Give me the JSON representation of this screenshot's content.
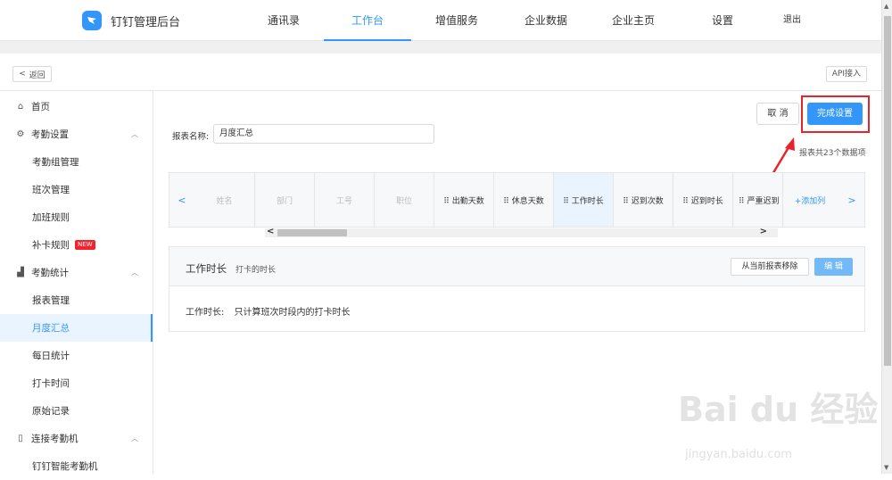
{
  "app": {
    "title": "钉钉管理后台"
  },
  "nav": [
    {
      "label": "通讯录",
      "active": false
    },
    {
      "label": "工作台",
      "active": true
    },
    {
      "label": "增值服务",
      "active": false
    },
    {
      "label": "企业数据",
      "active": false
    },
    {
      "label": "企业主页",
      "active": false
    },
    {
      "label": "设置",
      "active": false
    },
    {
      "label": "退出",
      "active": false
    }
  ],
  "subbar": {
    "back_label": "返回",
    "api_label": "API接入"
  },
  "sidebar": {
    "items": [
      {
        "label": "首页",
        "type": "group",
        "icon": "home-icon",
        "caret": false
      },
      {
        "label": "考勤设置",
        "type": "group",
        "icon": "settings-icon",
        "caret": true
      },
      {
        "label": "考勤组管理",
        "type": "sub"
      },
      {
        "label": "班次管理",
        "type": "sub"
      },
      {
        "label": "加班规则",
        "type": "sub"
      },
      {
        "label": "补卡规则",
        "type": "sub",
        "badge": "NEW"
      },
      {
        "label": "考勤统计",
        "type": "group",
        "icon": "chart-icon",
        "caret": true
      },
      {
        "label": "报表管理",
        "type": "sub"
      },
      {
        "label": "月度汇总",
        "type": "sub",
        "active": true
      },
      {
        "label": "每日统计",
        "type": "sub"
      },
      {
        "label": "打卡时间",
        "type": "sub"
      },
      {
        "label": "原始记录",
        "type": "sub"
      },
      {
        "label": "连接考勤机",
        "type": "group",
        "icon": "device-icon",
        "caret": true
      },
      {
        "label": "钉钉智能考勤机",
        "type": "sub"
      }
    ]
  },
  "report": {
    "name_label": "报表名称:",
    "name_value": "月度汇总",
    "cancel_label": "取 消",
    "done_label": "完成设置",
    "count_text": "报表共23个数据项"
  },
  "table": {
    "columns": [
      {
        "label": "姓名",
        "style": "disabled"
      },
      {
        "label": "部门",
        "style": "disabled"
      },
      {
        "label": "工号",
        "style": "disabled"
      },
      {
        "label": "职位",
        "style": "disabled"
      },
      {
        "label": "⠿ 出勤天数",
        "style": "normal"
      },
      {
        "label": "⠿ 休息天数",
        "style": "normal"
      },
      {
        "label": "⠿ 工作时长",
        "style": "selected"
      },
      {
        "label": "⠿ 迟到次数",
        "style": "normal"
      },
      {
        "label": "⠿ 迟到时长",
        "style": "normal"
      },
      {
        "label": "⠿ 严重迟到",
        "style": "normal"
      },
      {
        "label": "+添加列",
        "style": "add"
      }
    ]
  },
  "detail": {
    "title": "工作时长",
    "subtitle": "打卡的时长",
    "remove_label": "从当前报表移除",
    "edit_label": "编 辑",
    "body_key": "工作时长:",
    "body_value": "只计算班次时段内的打卡时长"
  },
  "watermark": {
    "brand": "Bai du 经验",
    "url": "jingyan.baidu.com"
  },
  "colors": {
    "accent": "#3296fa",
    "highlight": "#e8242a",
    "badge": "#f5222d"
  }
}
